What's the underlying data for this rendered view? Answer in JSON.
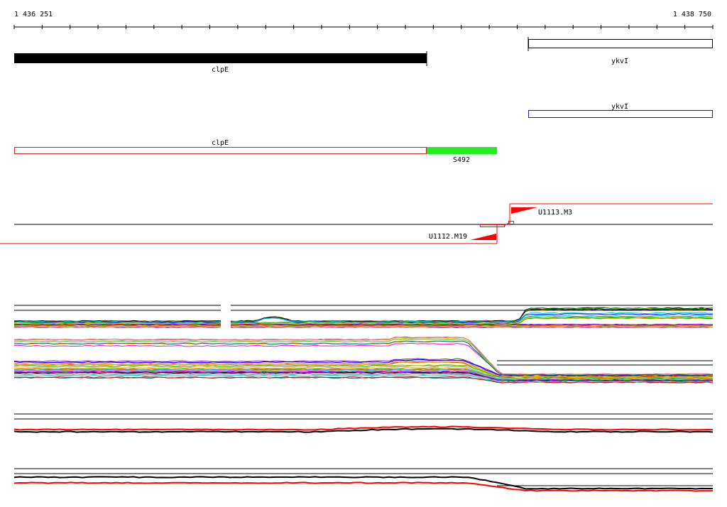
{
  "ruler": {
    "start_label": "1 436 251",
    "end_label": "1 438 750",
    "start": 1436251,
    "end": 1438750
  },
  "genes": {
    "clpE_top": {
      "label": "clpE",
      "strand": "+",
      "start": 1436251,
      "end": 1437732,
      "color": "#000000"
    },
    "ykvI_top": {
      "label": "ykvI",
      "strand": "+",
      "start": 1438092,
      "end": 1438750,
      "color": "#000000"
    },
    "ykvI_mid": {
      "label": "ykvI",
      "strand": "-",
      "start": 1438092,
      "end": 1438750,
      "color": "#1a1aa8"
    },
    "clpE_mid": {
      "label": "clpE",
      "strand": "-",
      "start": 1436251,
      "end": 1437732,
      "color": "#cc2222"
    },
    "S492": {
      "label": "S492",
      "start": 1437732,
      "end": 1437985,
      "color": "#22ee22"
    }
  },
  "transcripts": {
    "U1113": {
      "label": "U1113.M3",
      "color": "#ff0000"
    },
    "U1112": {
      "label": "U1112.M19",
      "color": "#ff0000"
    }
  },
  "tracks": {
    "palette": [
      "#000000",
      "#ff0000",
      "#00aa00",
      "#0000ff",
      "#ff00ff",
      "#00cccc",
      "#ffcc00",
      "#888888",
      "#aa6600",
      "#66ff66",
      "#9900cc",
      "#ff6699",
      "#3399ff",
      "#cccc00",
      "#006666",
      "#ff9900",
      "#33cc33",
      "#999999"
    ],
    "overlay_colors": [
      "#ff0000",
      "#000000"
    ]
  }
}
